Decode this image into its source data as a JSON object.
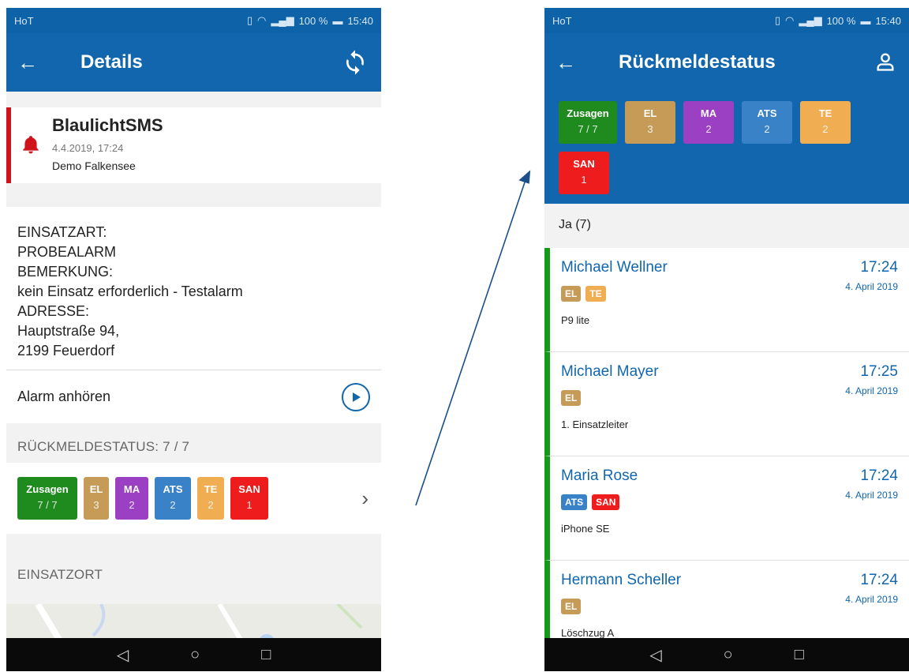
{
  "colors": {
    "primary": "#1166ad",
    "statusbar": "#0e63a8",
    "zusagen": "#1f8b1f",
    "EL": "#c69b58",
    "MA": "#9b3fc3",
    "ATS": "#3a82c8",
    "TE": "#f0ad52",
    "SAN": "#ee1c1c",
    "alarm_red": "#d0121b",
    "list_green": "#149a1a"
  },
  "left": {
    "status": {
      "carrier": "HoT",
      "battery": "100 %",
      "time": "15:40"
    },
    "appbar": {
      "title": "Details",
      "back_icon": "arrow-left-icon",
      "action_icon": "refresh-icon"
    },
    "alert": {
      "app_name": "BlaulichtSMS",
      "timestamp": "4.4.2019, 17:24",
      "org": "Demo Falkensee"
    },
    "message_lines": [
      "EINSATZART:",
      "PROBEALARM",
      "BEMERKUNG:",
      "kein Einsatz erforderlich - Testalarm",
      "ADRESSE:",
      "Hauptstraße 94,",
      "2199 Feuerdorf"
    ],
    "audio_label": "Alarm anhören",
    "response_title": "RÜCKMELDESTATUS: 7 / 7",
    "chips": [
      {
        "label": "Zusagen",
        "count": "7 / 7",
        "color": "#1f8b1f"
      },
      {
        "label": "EL",
        "count": "3",
        "color": "#c69b58"
      },
      {
        "label": "MA",
        "count": "2",
        "color": "#9b3fc3"
      },
      {
        "label": "ATS",
        "count": "2",
        "color": "#3a82c8"
      },
      {
        "label": "TE",
        "count": "2",
        "color": "#f0ad52"
      },
      {
        "label": "SAN",
        "count": "1",
        "color": "#ee1c1c"
      }
    ],
    "location_title": "EINSATZORT"
  },
  "right": {
    "status": {
      "carrier": "HoT",
      "battery": "100 %",
      "time": "15:40"
    },
    "appbar": {
      "title": "Rückmeldestatus",
      "back_icon": "arrow-left-icon",
      "action_icon": "person-icon"
    },
    "chips": [
      {
        "label": "Zusagen",
        "count": "7 / 7",
        "color": "#1f8b1f"
      },
      {
        "label": "EL",
        "count": "3",
        "color": "#c69b58"
      },
      {
        "label": "MA",
        "count": "2",
        "color": "#9b3fc3"
      },
      {
        "label": "ATS",
        "count": "2",
        "color": "#3a82c8"
      },
      {
        "label": "TE",
        "count": "2",
        "color": "#f0ad52"
      },
      {
        "label": "SAN",
        "count": "1",
        "color": "#ee1c1c"
      }
    ],
    "group_header": "Ja (7)",
    "members": [
      {
        "name": "Michael Wellner",
        "time": "17:24",
        "date": "4. April 2019",
        "device": "P9 lite",
        "badges": [
          {
            "t": "EL",
            "c": "#c69b58"
          },
          {
            "t": "TE",
            "c": "#f0ad52"
          }
        ]
      },
      {
        "name": "Michael Mayer",
        "time": "17:25",
        "date": "4. April 2019",
        "device": "1. Einsatzleiter",
        "badges": [
          {
            "t": "EL",
            "c": "#c69b58"
          }
        ]
      },
      {
        "name": "Maria Rose",
        "time": "17:24",
        "date": "4. April 2019",
        "device": "iPhone SE",
        "badges": [
          {
            "t": "ATS",
            "c": "#3a82c8"
          },
          {
            "t": "SAN",
            "c": "#ee1c1c"
          }
        ]
      },
      {
        "name": "Hermann Scheller",
        "time": "17:24",
        "date": "4. April 2019",
        "device": "Löschzug A",
        "badges": [
          {
            "t": "EL",
            "c": "#c69b58"
          }
        ]
      }
    ]
  }
}
